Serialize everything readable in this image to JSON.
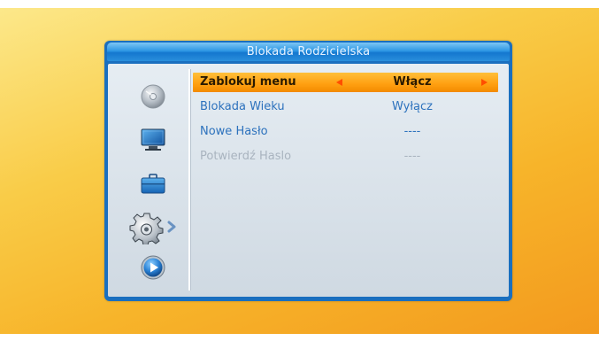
{
  "dialog": {
    "title": "Blokada Rodzicielska"
  },
  "sidebar": {
    "items": [
      {
        "icon": "disc-icon"
      },
      {
        "icon": "monitor-icon"
      },
      {
        "icon": "briefcase-icon"
      },
      {
        "icon": "gear-icon",
        "active": true
      },
      {
        "icon": "play-icon"
      }
    ]
  },
  "settings": [
    {
      "label": "Zablokuj menu",
      "value": "Włącz",
      "state": "selected"
    },
    {
      "label": "Blokada Wieku",
      "value": "Wyłącz",
      "state": "normal"
    },
    {
      "label": "Nowe Hasło",
      "value": "----",
      "state": "normal"
    },
    {
      "label": "Potwierdź Haslo",
      "value": "----",
      "state": "disabled"
    }
  ],
  "colors": {
    "title_bar": "#1a6fbf",
    "selection": "#ff9f10",
    "label_text": "#2d72bd",
    "disabled_text": "#a9b4bf",
    "arrow": "#ff4e00"
  }
}
